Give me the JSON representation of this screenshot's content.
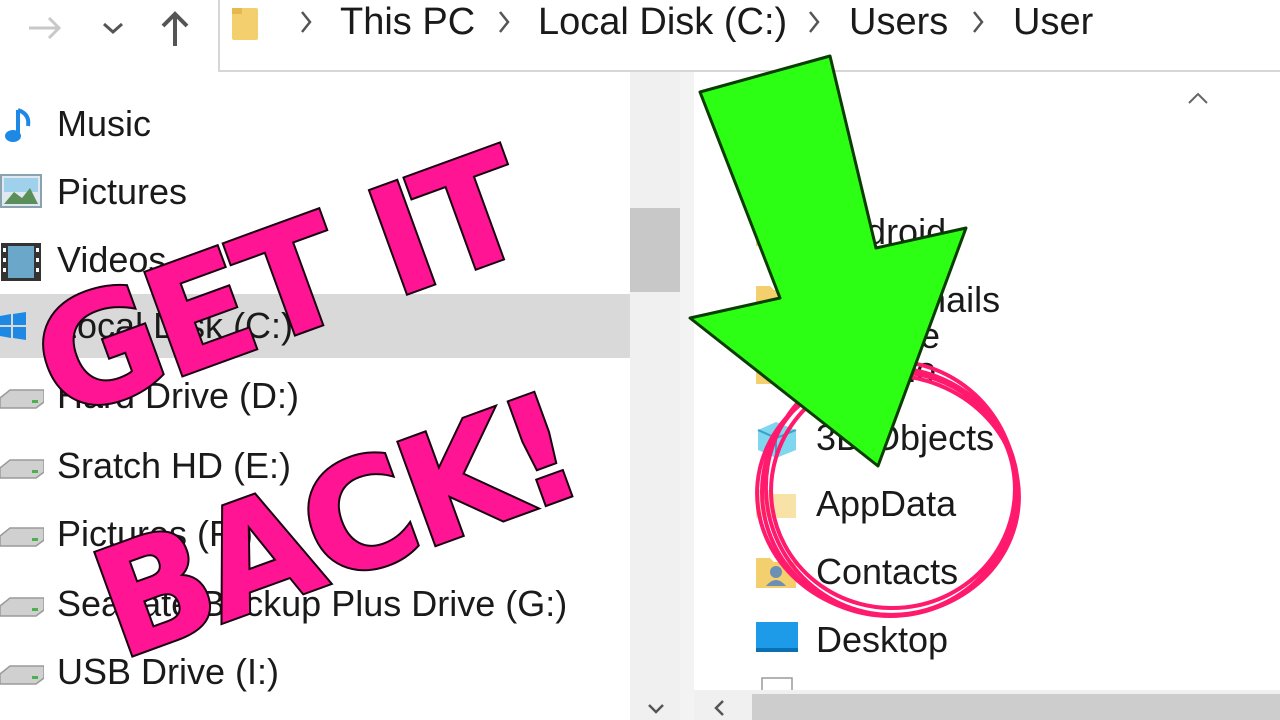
{
  "nav": {
    "back_icon": "arrow-left-icon",
    "forward_icon": "arrow-right-icon",
    "recent_icon": "chevron-down-icon",
    "up_icon": "arrow-up-icon"
  },
  "breadcrumb": {
    "items": [
      "This PC",
      "Local Disk (C:)",
      "Users",
      "User"
    ]
  },
  "sidebar": {
    "items": [
      {
        "label": "Music",
        "icon": "music-note-icon"
      },
      {
        "label": "Pictures",
        "icon": "pictures-icon"
      },
      {
        "label": "Videos",
        "icon": "videos-icon"
      },
      {
        "label": "Local Disk (C:)",
        "icon": "windows-drive-icon",
        "selected": true
      },
      {
        "label": "Hard Drive (D:)",
        "icon": "drive-icon"
      },
      {
        "label": "Sratch HD (E:)",
        "icon": "drive-icon"
      },
      {
        "label": "Pictures (F:)",
        "icon": "drive-icon"
      },
      {
        "label": "Seagate Backup Plus Drive (G:)",
        "icon": "drive-icon"
      },
      {
        "label": "USB Drive (I:)",
        "icon": "drive-icon"
      }
    ]
  },
  "files": {
    "items": [
      {
        "label": ".android",
        "icon": "folder-icon"
      },
      {
        "label": ".thumbnails",
        "icon": "folder-icon"
      },
      {
        "label": ".vscode",
        "icon": "folder-icon"
      },
      {
        "label": ".dermio",
        "icon": "folder-icon"
      },
      {
        "label": "3D Objects",
        "icon": "3d-objects-icon"
      },
      {
        "label": "AppData",
        "icon": "folder-icon"
      },
      {
        "label": "Contacts",
        "icon": "contacts-icon"
      },
      {
        "label": "Desktop",
        "icon": "desktop-icon"
      }
    ]
  },
  "overlay": {
    "line1": "GET IT",
    "line2": "BACK!"
  },
  "colors": {
    "accent_pink": "#ff1493",
    "circle_pink": "#ff1a6e",
    "arrow_green": "#2dff14"
  }
}
